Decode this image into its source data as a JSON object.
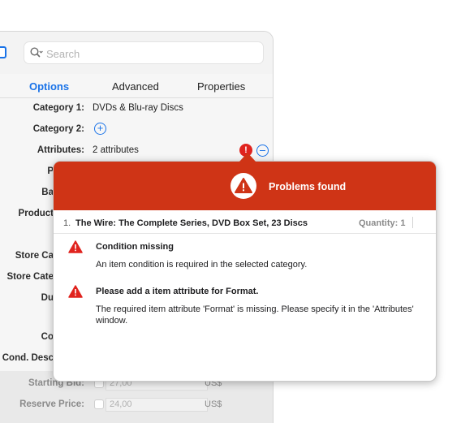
{
  "search": {
    "placeholder": "Search"
  },
  "tabs": [
    {
      "label": "Options",
      "active": true
    },
    {
      "label": "Advanced",
      "active": false
    },
    {
      "label": "Properties",
      "active": false
    }
  ],
  "form": {
    "category1_label": "Category 1:",
    "category1_value": "DVDs & Blu-ray Discs",
    "category2_label": "Category 2:",
    "attributes_label": "Attributes:",
    "attributes_value": "2 attributes",
    "partial_labels": [
      "P",
      "Ba",
      "Product",
      "Store Ca",
      "Store Cate",
      "Du",
      "Co",
      "Cond. Desc"
    ],
    "starting_bid_label": "Starting Bid:",
    "starting_bid_value": "27,00",
    "reserve_price_label": "Reserve Price:",
    "reserve_price_value": "24,00",
    "currency": "US$",
    "error_badge": "!"
  },
  "popover": {
    "title": "Problems found",
    "item": {
      "number": "1.",
      "name": "The Wire: The Complete Series, DVD Box Set, 23 Discs",
      "quantity": "Quantity: 1"
    },
    "problems": [
      {
        "title": "Condition missing",
        "description": "An item condition is required in the selected category."
      },
      {
        "title": "Please add a item attribute for Format.",
        "description": "The required item attribute 'Format' is missing. Please specify it in the 'Attributes' window."
      }
    ]
  },
  "colors": {
    "accent": "#1a73e8",
    "error_header": "#cf3416",
    "error_icon": "#e0231e"
  }
}
